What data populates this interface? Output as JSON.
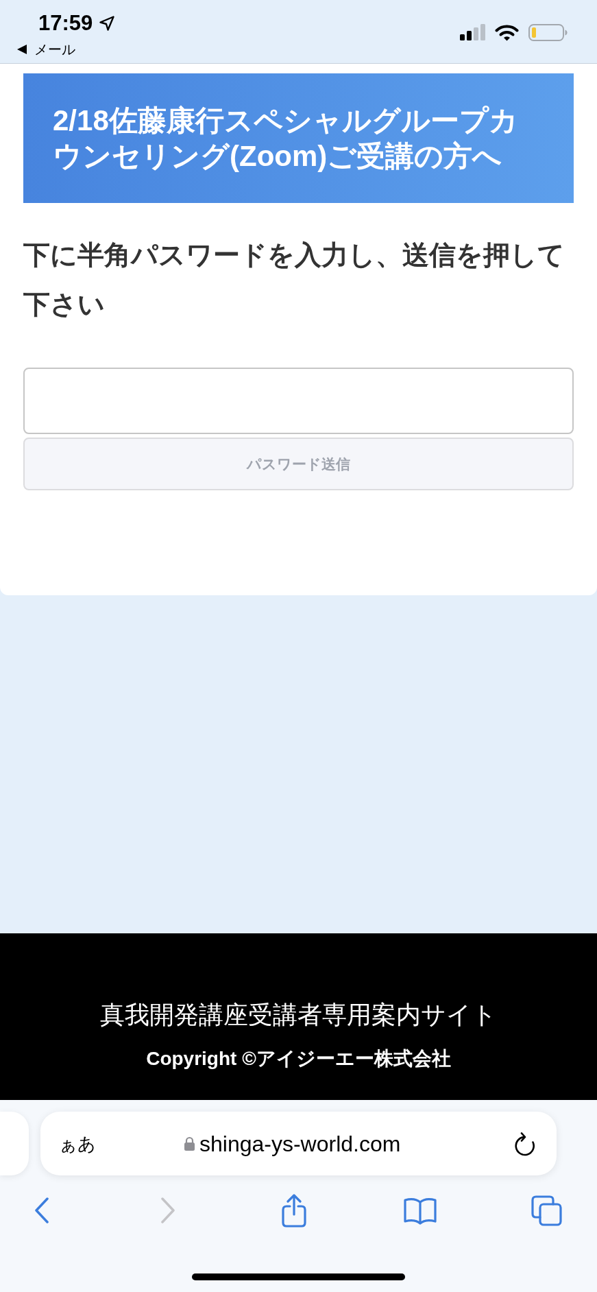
{
  "status_bar": {
    "time": "17:59",
    "back_label": "メール"
  },
  "page": {
    "banner_title": "2/18佐藤康行スペシャルグループカウンセリング(Zoom)ご受講の方へ",
    "instruction": "下に半角パスワードを入力し、送信を押して下さい",
    "submit_button": {
      "label": "パスワード送信",
      "disabled": true
    }
  },
  "footer": {
    "site_name": "真我開発講座受講者専用案内サイト",
    "copyright": "Copyright ©アイジーエー株式会社"
  },
  "browser": {
    "text_size_button": "ぁあ",
    "url": "shinga-ys-world.com",
    "toolbar": [
      {
        "kind": "back",
        "disabled": false
      },
      {
        "kind": "forward",
        "disabled": true
      },
      {
        "kind": "share",
        "disabled": false
      },
      {
        "kind": "bookmarks",
        "disabled": false
      },
      {
        "kind": "tabs",
        "disabled": false
      }
    ]
  }
}
